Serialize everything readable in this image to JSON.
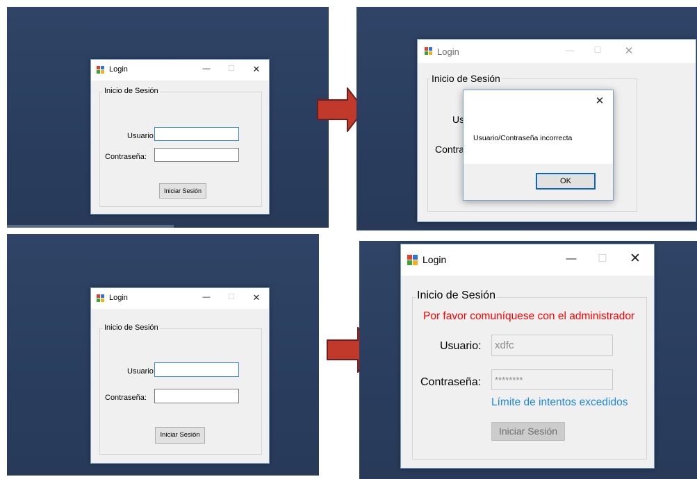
{
  "login": {
    "title": "Login",
    "minimize": "—",
    "maximize": "☐",
    "close": "✕",
    "group_label": "Inicio de Sesión",
    "user_label": "Usuario:",
    "pass_label": "Contraseña:",
    "submit_label": "Iniciar Sesión"
  },
  "error_dialog": {
    "message": "Usuario/Contraseña incorrecta",
    "ok_label": "OK",
    "close": "✕",
    "partial_user_label": "Us",
    "partial_pass_label": "Contra"
  },
  "locked_state": {
    "warning": "Por favor comuníquese con el administrador",
    "user_value": "xdfc",
    "pass_value": "********",
    "limit_message": "Límite de intentos excedidos"
  },
  "colors": {
    "warning": "#ff0000",
    "limit": "#1e88d8",
    "arrow_fill": "#c0392b",
    "desktop": "#2c3f60"
  }
}
